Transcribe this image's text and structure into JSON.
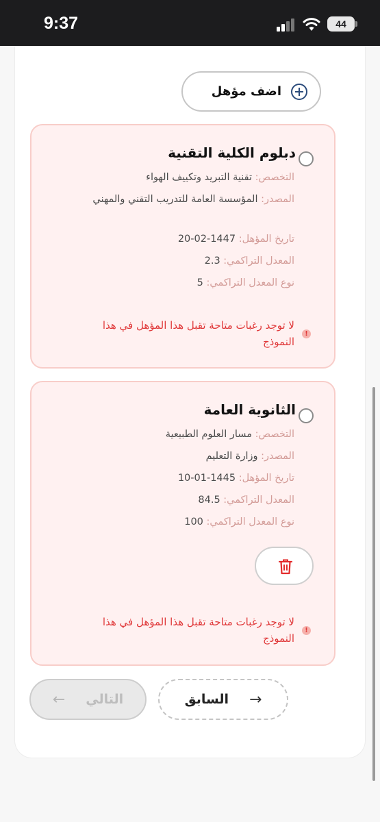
{
  "status_bar": {
    "time": "9:37",
    "battery": "44"
  },
  "add_button": {
    "label": "اضف مؤهل",
    "icon": "plus-circle-icon"
  },
  "qualifications": [
    {
      "title": "دبلوم الكلية التقنية",
      "specialization_key": "التخصص:",
      "specialization": "تقنية التبريد وتكييف الهواء",
      "source_key": "المصدر:",
      "source": "المؤسسة العامة للتدريب التقني والمهني",
      "date_key": "تاريخ المؤهل:",
      "date": "1447-02-20",
      "gpa_key": "المعدل التراكمي:",
      "gpa": "2.3",
      "gpa_type_key": "نوع المعدل التراكمي:",
      "gpa_type": "5",
      "warning": "لا توجد رغبات متاحة تقبل هذا المؤهل في هذا النموذج"
    },
    {
      "title": "الثانوية العامة",
      "specialization_key": "التخصص:",
      "specialization": "مسار العلوم الطبيعية",
      "source_key": "المصدر:",
      "source": "وزارة التعليم",
      "date_key": "تاريخ المؤهل:",
      "date": "1445-01-10",
      "gpa_key": "المعدل التراكمي:",
      "gpa": "84.5",
      "gpa_type_key": "نوع المعدل التراكمي:",
      "gpa_type": "100",
      "warning": "لا توجد رغبات متاحة تقبل هذا المؤهل في هذا النموذج"
    }
  ],
  "navigation": {
    "next_label": "التالي",
    "prev_label": "السابق"
  },
  "colors": {
    "card_bg": "#fff1f1",
    "card_border": "#f8cdc9",
    "warning": "#e0393a",
    "delete": "#e32b2b"
  }
}
